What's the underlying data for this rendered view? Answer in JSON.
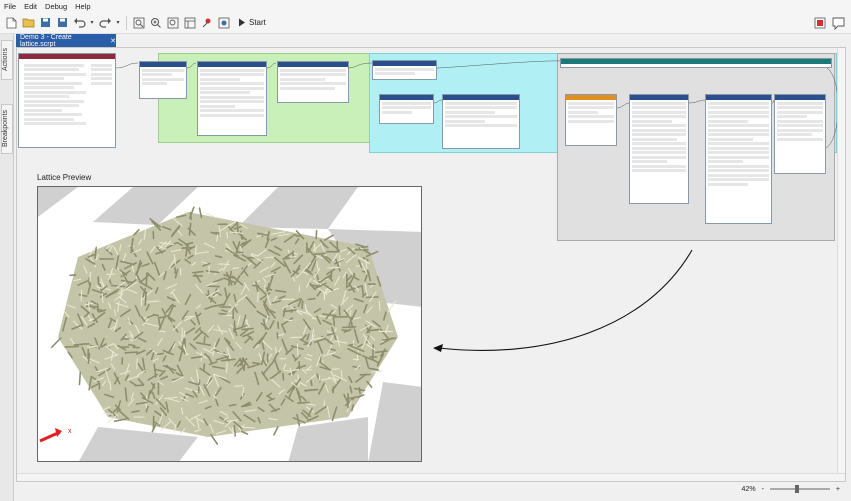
{
  "menu": {
    "items": [
      "File",
      "Edit",
      "Debug",
      "Help"
    ]
  },
  "toolbar": {
    "start_label": "Start"
  },
  "side_tabs": {
    "actions": "Actions",
    "breakpoints": "Breakpoints"
  },
  "document_tab": {
    "title": "Demo 3 - Create lattice.scrpt",
    "close": "✕"
  },
  "preview": {
    "title": "Lattice Preview",
    "axis_x_label": "x"
  },
  "zoom": {
    "level": "42%",
    "minus": "-",
    "plus": "+"
  },
  "colors": {
    "accent": "#2a5ea8",
    "green_group": "#c8f0b8",
    "cyan_group": "#b0f0f4",
    "lattice_fill": "#b8b89a",
    "lattice_stroke": "#7a7a5a"
  }
}
